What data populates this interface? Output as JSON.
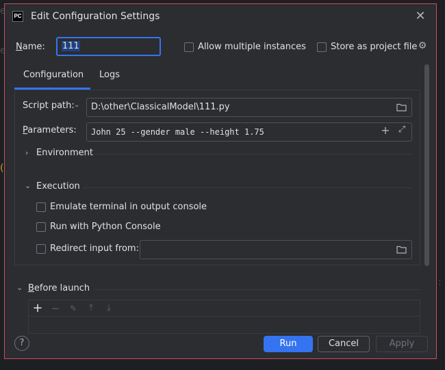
{
  "window": {
    "title": "Edit Configuration Settings",
    "logo_text": "PC"
  },
  "name_field": {
    "label": "Name:",
    "value": "111"
  },
  "options": {
    "allow_multiple": "Allow multiple instances",
    "store_as_project": "Store as project file"
  },
  "tabs": [
    {
      "label": "Configuration",
      "active": true
    },
    {
      "label": "Logs",
      "active": false
    }
  ],
  "script": {
    "label": "Script path:",
    "value": "D:\\other\\ClassicalModel\\111.py"
  },
  "parameters": {
    "label": "Parameters:",
    "value": "John 25 --gender male --height 1.75"
  },
  "sections": {
    "environment": {
      "label": "Environment",
      "expanded": false
    },
    "execution": {
      "label": "Execution",
      "expanded": true
    }
  },
  "execution": {
    "emulate_terminal": "Emulate terminal in output console",
    "python_console": "Run with Python Console",
    "redirect_input": {
      "label": "Redirect input from:",
      "value": ""
    }
  },
  "before_launch": {
    "label": "Before launch"
  },
  "buttons": {
    "run": "Run",
    "cancel": "Cancel",
    "apply": "Apply"
  },
  "help": "?"
}
